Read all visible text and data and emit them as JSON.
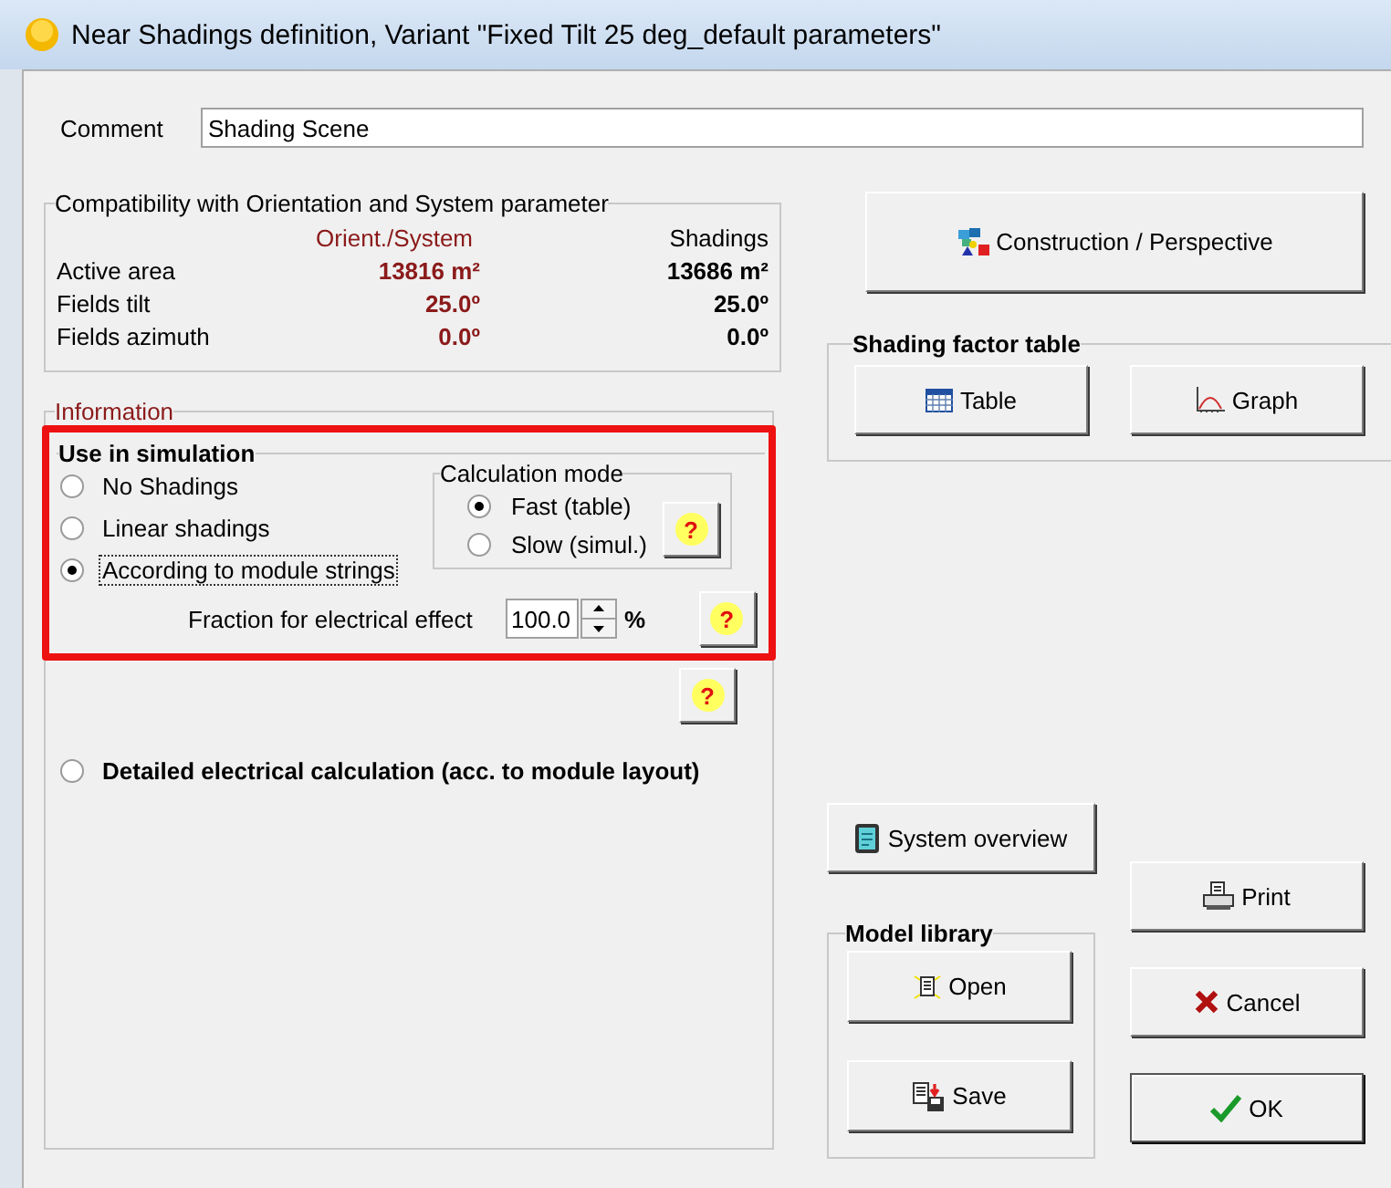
{
  "window": {
    "title": "Near Shadings definition, Variant \"Fixed Tilt 25 deg_default parameters\""
  },
  "comment": {
    "label": "Comment",
    "value": "Shading Scene"
  },
  "compatibility": {
    "title": "Compatibility with Orientation and System parameter",
    "columns": [
      "Orient./System",
      "Shadings"
    ],
    "rows": [
      {
        "label": "Active area",
        "orient": "13816 m²",
        "shadings": "13686 m²"
      },
      {
        "label": "Fields tilt",
        "orient": "25.0º",
        "shadings": "25.0º"
      },
      {
        "label": "Fields azimuth",
        "orient": "0.0º",
        "shadings": "0.0º"
      }
    ]
  },
  "information": {
    "title": "Information"
  },
  "use_in_simulation": {
    "title": "Use in simulation",
    "highlighted": true,
    "options": [
      {
        "label": "No Shadings",
        "selected": false,
        "focused": false
      },
      {
        "label": "Linear shadings",
        "selected": false,
        "focused": false
      },
      {
        "label": "According to module strings",
        "selected": true,
        "focused": true
      }
    ],
    "calculation_mode": {
      "title": "Calculation mode",
      "options": [
        {
          "label": "Fast (table)",
          "selected": true
        },
        {
          "label": "Slow (simul.)",
          "selected": false
        }
      ],
      "help": "?"
    },
    "fraction": {
      "label": "Fraction for electrical effect",
      "value": "100.0",
      "unit": "%",
      "help": "?"
    },
    "help": "?"
  },
  "detailed_option": {
    "label": "Detailed electrical calculation (acc. to module layout)",
    "selected": false
  },
  "construction_button": {
    "label": "Construction / Perspective"
  },
  "shading_factor_table": {
    "title": "Shading factor table",
    "buttons": [
      {
        "label": "Table",
        "kind": "table"
      },
      {
        "label": "Graph",
        "kind": "graph"
      }
    ]
  },
  "system_overview_button": {
    "label": "System overview"
  },
  "model_library": {
    "title": "Model library",
    "buttons": [
      {
        "label": "Open",
        "kind": "open"
      },
      {
        "label": "Save",
        "kind": "save"
      }
    ]
  },
  "dialog_buttons": [
    {
      "label": "Print",
      "kind": "print",
      "default": false
    },
    {
      "label": "Cancel",
      "kind": "cancel",
      "default": false
    },
    {
      "label": "OK",
      "kind": "ok",
      "default": true
    }
  ]
}
